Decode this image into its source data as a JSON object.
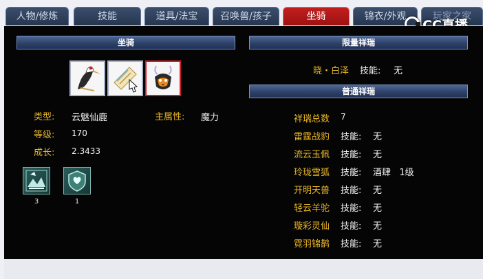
{
  "tabs": [
    {
      "label": "人物/修炼",
      "active": false
    },
    {
      "label": "技能",
      "active": false
    },
    {
      "label": "道具/法宝",
      "active": false
    },
    {
      "label": "召唤兽/孩子",
      "active": false
    },
    {
      "label": "坐骑",
      "active": true
    },
    {
      "label": "锦衣/外观",
      "active": false
    },
    {
      "label": "玩家之家",
      "active": false
    }
  ],
  "watermark": "CC直播",
  "left": {
    "header": "坐骑",
    "mount_slots": [
      "crane-mount-icon",
      "scroll-mount-icon",
      "fox-mount-icon"
    ],
    "type_label": "类型:",
    "type_value": "云魅仙鹿",
    "attr_label": "主属性:",
    "attr_value": "魔力",
    "level_label": "等级:",
    "level_value": "170",
    "growth_label": "成长:",
    "growth_value": "2.3433",
    "skills": [
      {
        "icon": "mountain-skill-icon",
        "count": "3"
      },
      {
        "icon": "heart-shield-skill-icon",
        "count": "1"
      }
    ]
  },
  "right": {
    "limited_header": "限量祥瑞",
    "limited_name": "晓・白泽",
    "limited_skill_label": "技能:",
    "limited_skill_value": "无",
    "normal_header": "普通祥瑞",
    "total_label": "祥瑞总数",
    "total_value": "7",
    "items": [
      {
        "name": "雷霆战豹",
        "skill_label": "技能:",
        "skill": "无"
      },
      {
        "name": "流云玉佩",
        "skill_label": "技能:",
        "skill": "无"
      },
      {
        "name": "玲珑雪狐",
        "skill_label": "技能:",
        "skill": "酒肆   1级"
      },
      {
        "name": "开明天兽",
        "skill_label": "技能:",
        "skill": "无"
      },
      {
        "name": "轻云羊驼",
        "skill_label": "技能:",
        "skill": "无"
      },
      {
        "name": "璇彩灵仙",
        "skill_label": "技能:",
        "skill": "无"
      },
      {
        "name": "霓羽锦鹊",
        "skill_label": "技能:",
        "skill": "无"
      }
    ]
  }
}
